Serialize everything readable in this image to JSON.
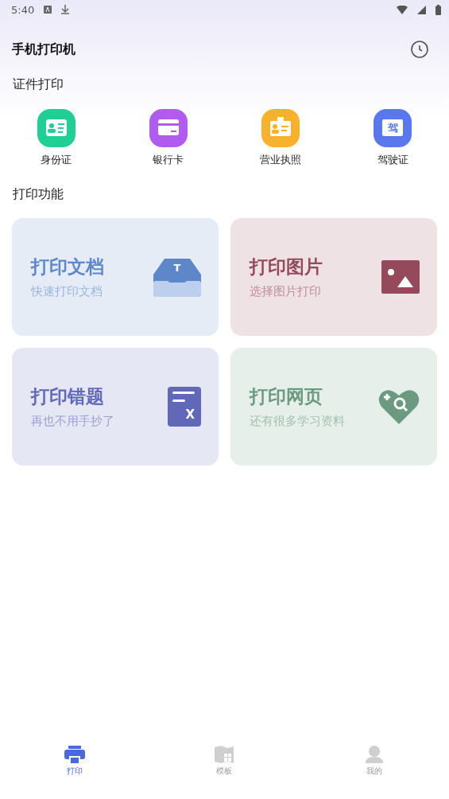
{
  "status_bar": {
    "time": "5:40"
  },
  "header": {
    "title": "手机打印机"
  },
  "id_section": {
    "title": "证件打印",
    "items": [
      {
        "label": "身份证",
        "kind": "id",
        "color": "#1fcf93"
      },
      {
        "label": "银行卡",
        "kind": "card",
        "color": "#b05cf0"
      },
      {
        "label": "营业执照",
        "kind": "badge",
        "color": "#f7b12a"
      },
      {
        "label": "驾驶证",
        "kind": "license",
        "color": "#5a78ee",
        "glyph": "驾"
      }
    ]
  },
  "print_section": {
    "title": "打印功能",
    "cards": [
      {
        "title": "打印文档",
        "subtitle": "快速打印文档",
        "kind": "tray",
        "color": "#5d87c9",
        "glyph": "T"
      },
      {
        "title": "打印图片",
        "subtitle": "选择图片打印",
        "kind": "image",
        "color": "#944a5a"
      },
      {
        "title": "打印错题",
        "subtitle": "再也不用手抄了",
        "kind": "sheet",
        "color": "#6168b8",
        "glyph": "X"
      },
      {
        "title": "打印网页",
        "subtitle": "还有很多学习资料",
        "kind": "heart",
        "color": "#6b9a80"
      }
    ]
  },
  "nav": [
    {
      "label": "打印",
      "kind": "printer",
      "selected": true
    },
    {
      "label": "模板",
      "kind": "map",
      "selected": false
    },
    {
      "label": "我的",
      "kind": "person",
      "selected": false
    }
  ]
}
